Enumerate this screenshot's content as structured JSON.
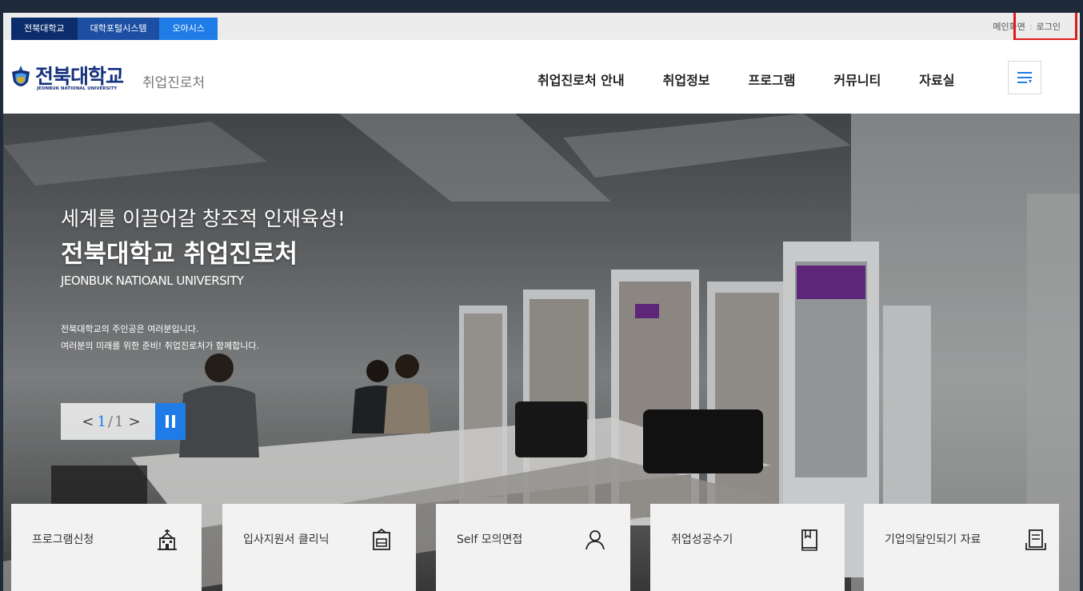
{
  "topbar": {
    "tabs": [
      {
        "label": "전북대학교"
      },
      {
        "label": "대학포털시스템"
      },
      {
        "label": "오아시스"
      }
    ],
    "util": {
      "home": "메인화면",
      "separator": ":",
      "login": "로그인"
    }
  },
  "header": {
    "logo_kr": "전북대학교",
    "logo_en": "JEONBUK NATIONAL UNIVERSITY",
    "site_name": "취업진로처",
    "menu": [
      "취업진로처 안내",
      "취업정보",
      "프로그램",
      "커뮤니티",
      "자료실"
    ]
  },
  "hero": {
    "title_line1": "세계를 이끌어갈 창조적 인재육성!",
    "title_line2": "전북대학교 취업진로처",
    "title_en": "JEONBUK NATIOANL UNIVERSITY",
    "desc_line1": "전북대학교의 주인공은 여러분입니다.",
    "desc_line2": "여러분의 미래를 위한 준비! 취업진로처가 함께합니다.",
    "pager": {
      "prev": "<",
      "current": "1",
      "divider": "/",
      "total": "1",
      "next": ">"
    }
  },
  "quick_links": [
    {
      "label": "프로그램신청",
      "icon": "building-icon"
    },
    {
      "label": "입사지원서 클리닉",
      "icon": "clipboard-icon"
    },
    {
      "label": "Self 모의면접",
      "icon": "person-icon"
    },
    {
      "label": "취업성공수기",
      "icon": "book-icon"
    },
    {
      "label": "기업의달인되기 자료",
      "icon": "document-icon"
    }
  ],
  "colors": {
    "brand_navy": "#15317e",
    "accent_blue": "#1f7be6",
    "highlight_red": "#e01b1b"
  }
}
